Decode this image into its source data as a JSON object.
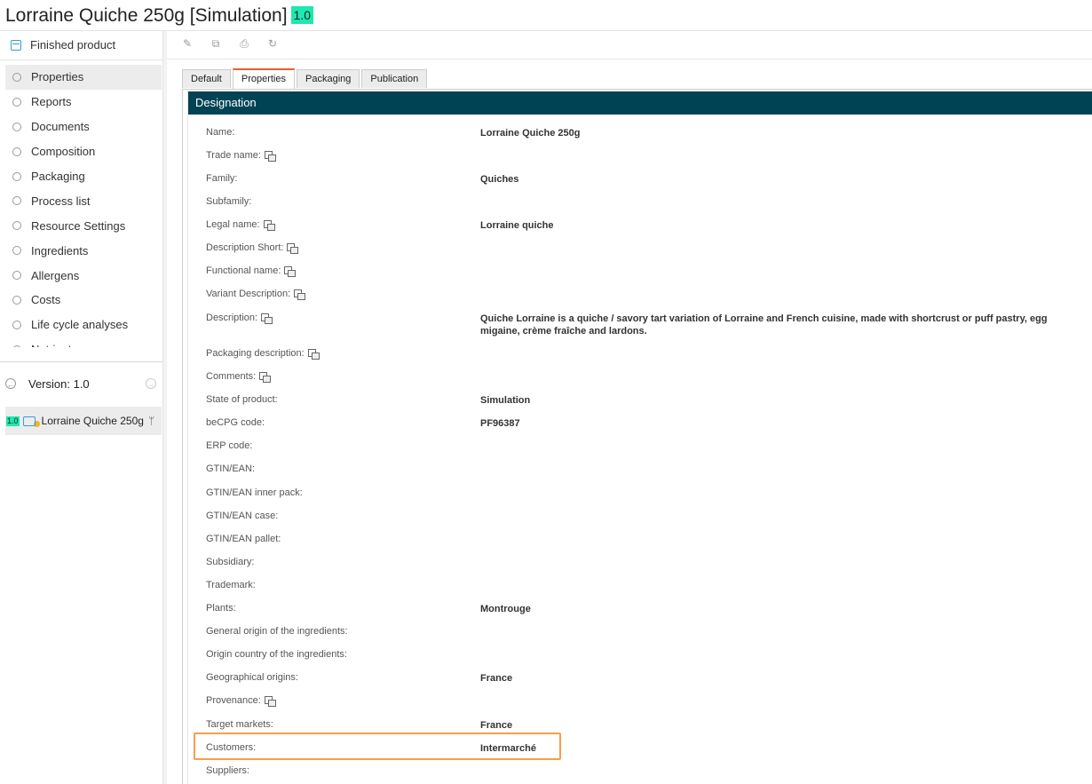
{
  "header": {
    "title": "Lorraine Quiche 250g [Simulation]",
    "version_badge": "1.0"
  },
  "sidebar": {
    "finished_product_label": "Finished product",
    "items": [
      {
        "label": "Properties",
        "active": true
      },
      {
        "label": "Reports"
      },
      {
        "label": "Documents"
      },
      {
        "label": "Composition"
      },
      {
        "label": "Packaging"
      },
      {
        "label": "Process list"
      },
      {
        "label": "Resource Settings"
      },
      {
        "label": "Ingredients"
      },
      {
        "label": "Allergens"
      },
      {
        "label": "Costs"
      },
      {
        "label": "Life cycle analyses"
      },
      {
        "label": "Nutrients"
      }
    ],
    "version_label": "Version: 1.0",
    "version_item": {
      "badge": "1.0",
      "name": "Lorraine Quiche 250g"
    }
  },
  "toolbar": {
    "icons": [
      "edit-icon",
      "copy-icon",
      "print-icon",
      "refresh-icon"
    ]
  },
  "tabs": [
    {
      "label": "Default"
    },
    {
      "label": "Properties",
      "active": true
    },
    {
      "label": "Packaging"
    },
    {
      "label": "Publication"
    }
  ],
  "section": {
    "title": "Designation"
  },
  "fields": [
    {
      "label": "Name:",
      "value": "Lorraine Quiche 250g"
    },
    {
      "label": "Trade name:",
      "translatable": true,
      "value": ""
    },
    {
      "label": "Family:",
      "value": "Quiches"
    },
    {
      "label": "Subfamily:",
      "value": ""
    },
    {
      "label": "Legal name:",
      "translatable": true,
      "value": "Lorraine quiche"
    },
    {
      "label": "Description Short:",
      "translatable": true,
      "value": ""
    },
    {
      "label": "Functional name:",
      "translatable": true,
      "value": ""
    },
    {
      "label": "Variant Description:",
      "translatable": true,
      "value": ""
    },
    {
      "label": "Description:",
      "translatable": true,
      "value": "Quiche Lorraine is a quiche / savory tart variation of Lorraine and French cuisine, made with shortcrust or puff pastry, egg migaine, crème fraîche and lardons."
    },
    {
      "label": "Packaging description:",
      "translatable": true,
      "value": ""
    },
    {
      "label": "Comments:",
      "translatable": true,
      "value": ""
    },
    {
      "label": "State of product:",
      "value": "Simulation"
    },
    {
      "label": "beCPG code:",
      "value": "PF96387"
    },
    {
      "label": "ERP code:",
      "value": ""
    },
    {
      "label": "GTIN/EAN:",
      "value": ""
    },
    {
      "label": "GTIN/EAN inner pack:",
      "value": ""
    },
    {
      "label": "GTIN/EAN case:",
      "value": ""
    },
    {
      "label": "GTIN/EAN pallet:",
      "value": ""
    },
    {
      "label": "Subsidiary:",
      "value": ""
    },
    {
      "label": "Trademark:",
      "value": ""
    },
    {
      "label": "Plants:",
      "value": "Montrouge"
    },
    {
      "label": "General origin of the ingredients:",
      "value": ""
    },
    {
      "label": "Origin country of the ingredients:",
      "value": ""
    },
    {
      "label": "Geographical origins:",
      "value": "France"
    },
    {
      "label": "Provenance:",
      "translatable": true,
      "value": ""
    },
    {
      "label": "Target markets:",
      "value": "France"
    },
    {
      "label": "Customers:",
      "value": "Intermarché",
      "highlighted": true
    },
    {
      "label": "Suppliers:",
      "value": ""
    }
  ],
  "colors": {
    "section_bg": "#004354",
    "badge": "#1de8b0",
    "tab_accent": "#e95d2b",
    "highlight": "#f5a048"
  }
}
